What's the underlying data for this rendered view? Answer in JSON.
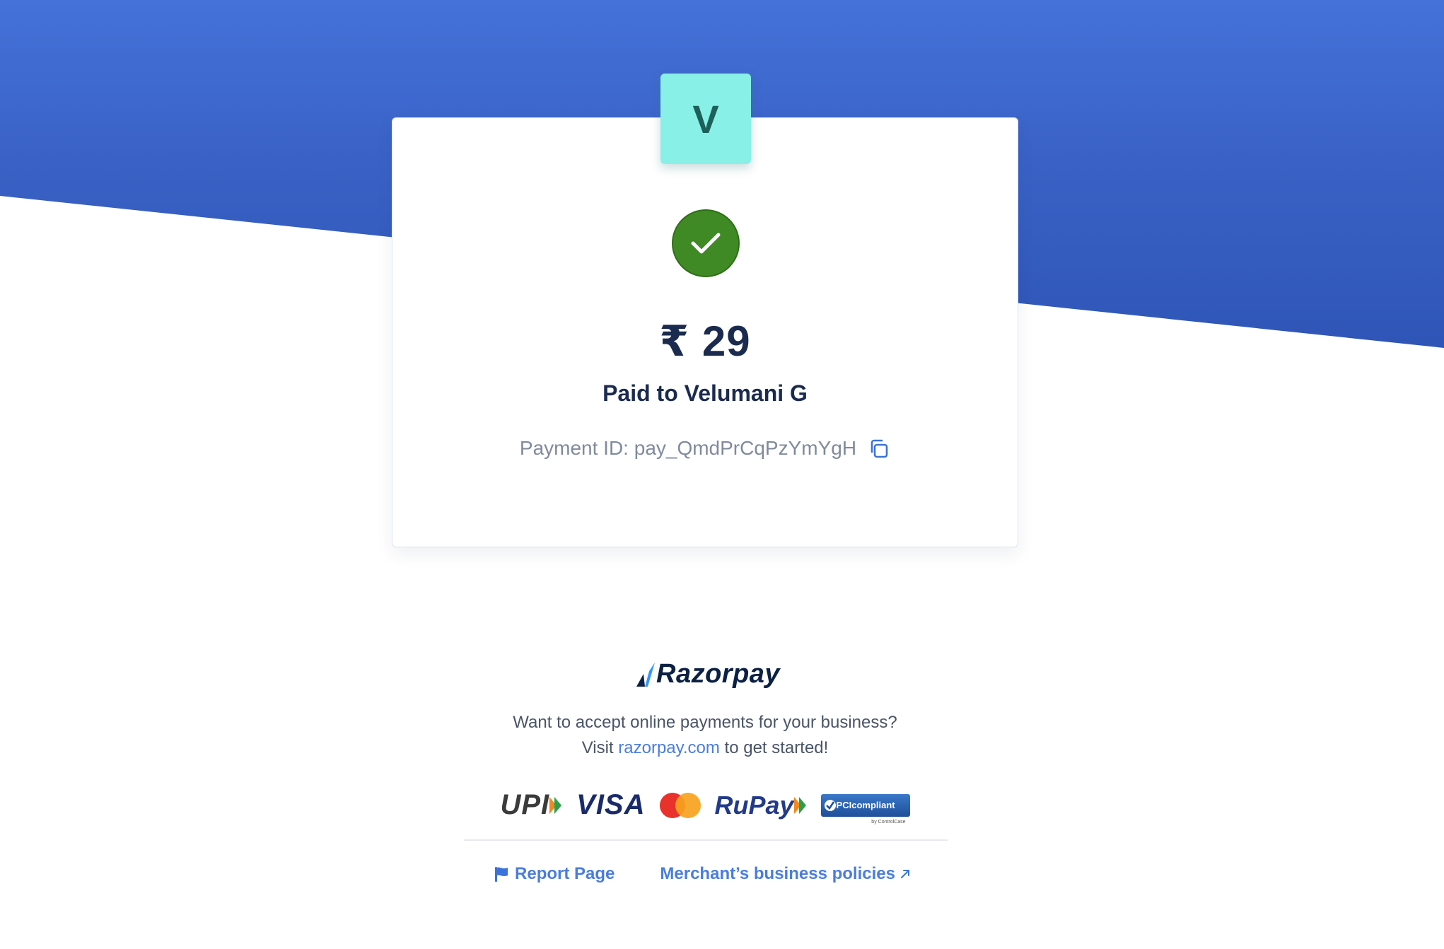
{
  "merchant": {
    "initial": "V"
  },
  "payment": {
    "amount": "₹ 29",
    "paid_to": "Paid to Velumani G",
    "id_label": "Payment ID: pay_QmdPrCqPzYmYgH"
  },
  "branding": {
    "logo_text": "Razorpay",
    "promo_line1": "Want to accept online payments for your business?",
    "promo_visit": "Visit",
    "promo_link": "razorpay.com",
    "promo_suffix": "to get started!"
  },
  "payment_methods": {
    "upi": "UPI",
    "visa": "VISA",
    "rupay": "RuPay",
    "pci": "PCIcompliant",
    "pci_sub": "by ControlCase"
  },
  "footer": {
    "report_label": "Report Page",
    "policies_label": "Merchant’s business policies"
  },
  "colors": {
    "hero_blue": "#3a62c6",
    "success_green": "#3f8a24",
    "avatar_teal": "#88f0e6",
    "link_blue": "#4a7de0",
    "text_dark": "#1b2b4f"
  },
  "icons": [
    "check-icon",
    "copy-icon",
    "razorpay-mark-icon",
    "flag-icon",
    "external-link-arrow-icon"
  ]
}
